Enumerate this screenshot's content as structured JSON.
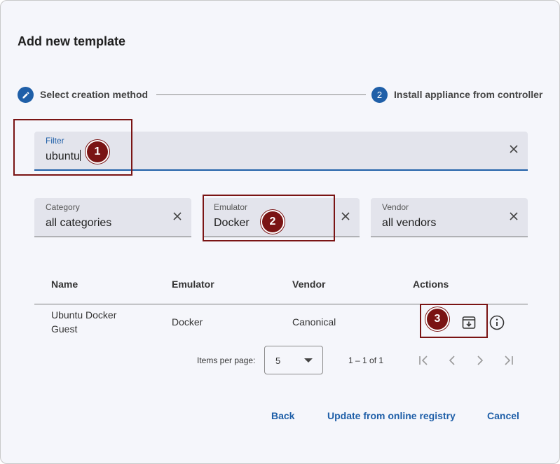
{
  "dialog": {
    "title": "Add new template"
  },
  "stepper": {
    "step1": {
      "icon": "pencil-icon",
      "label": "Select creation method"
    },
    "step2": {
      "number": "2",
      "label": "Install appliance from controller"
    }
  },
  "filter": {
    "label": "Filter",
    "value": "ubuntu"
  },
  "category": {
    "label": "Category",
    "value": "all categories"
  },
  "emulator": {
    "label": "Emulator",
    "value": "Docker"
  },
  "vendor": {
    "label": "Vendor",
    "value": "all vendors"
  },
  "annotations": [
    "1",
    "2",
    "3"
  ],
  "table": {
    "headers": [
      "Name",
      "Emulator",
      "Vendor",
      "Actions"
    ],
    "rows": [
      {
        "name": "Ubuntu Docker Guest",
        "name_line1": "Ubuntu Docker",
        "name_line2": "Guest",
        "emulator": "Docker",
        "vendor": "Canonical",
        "actions": [
          "download-icon",
          "info-icon"
        ]
      }
    ]
  },
  "paginator": {
    "items_per_page_label": "Items per page:",
    "page_size": "5",
    "range": "1 – 1 of 1"
  },
  "footer": {
    "back": "Back",
    "update": "Update from online registry",
    "cancel": "Cancel"
  },
  "colors": {
    "accent": "#1f5fa8",
    "annotation": "#7a1414",
    "dialog_bg": "#f5f6fb",
    "field_bg": "#e3e4ec"
  }
}
